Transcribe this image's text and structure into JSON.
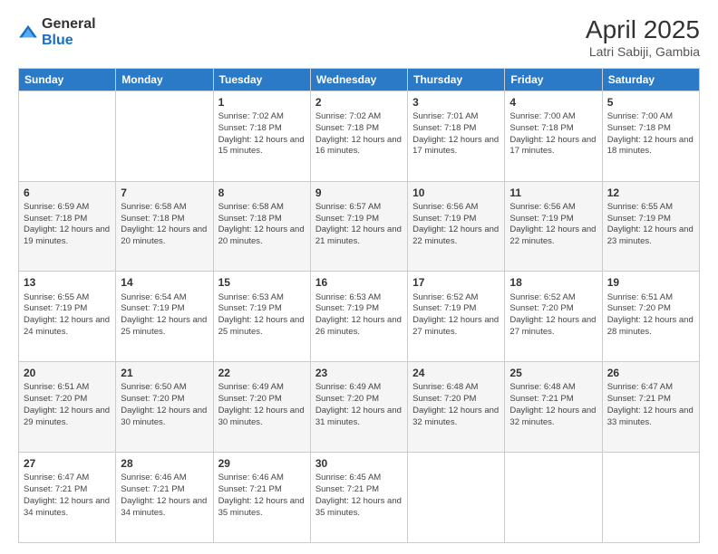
{
  "logo": {
    "general": "General",
    "blue": "Blue"
  },
  "header": {
    "title": "April 2025",
    "subtitle": "Latri Sabiji, Gambia"
  },
  "weekdays": [
    "Sunday",
    "Monday",
    "Tuesday",
    "Wednesday",
    "Thursday",
    "Friday",
    "Saturday"
  ],
  "weeks": [
    [
      {
        "day": "",
        "info": ""
      },
      {
        "day": "",
        "info": ""
      },
      {
        "day": "1",
        "info": "Sunrise: 7:02 AM\nSunset: 7:18 PM\nDaylight: 12 hours and 15 minutes."
      },
      {
        "day": "2",
        "info": "Sunrise: 7:02 AM\nSunset: 7:18 PM\nDaylight: 12 hours and 16 minutes."
      },
      {
        "day": "3",
        "info": "Sunrise: 7:01 AM\nSunset: 7:18 PM\nDaylight: 12 hours and 17 minutes."
      },
      {
        "day": "4",
        "info": "Sunrise: 7:00 AM\nSunset: 7:18 PM\nDaylight: 12 hours and 17 minutes."
      },
      {
        "day": "5",
        "info": "Sunrise: 7:00 AM\nSunset: 7:18 PM\nDaylight: 12 hours and 18 minutes."
      }
    ],
    [
      {
        "day": "6",
        "info": "Sunrise: 6:59 AM\nSunset: 7:18 PM\nDaylight: 12 hours and 19 minutes."
      },
      {
        "day": "7",
        "info": "Sunrise: 6:58 AM\nSunset: 7:18 PM\nDaylight: 12 hours and 20 minutes."
      },
      {
        "day": "8",
        "info": "Sunrise: 6:58 AM\nSunset: 7:18 PM\nDaylight: 12 hours and 20 minutes."
      },
      {
        "day": "9",
        "info": "Sunrise: 6:57 AM\nSunset: 7:19 PM\nDaylight: 12 hours and 21 minutes."
      },
      {
        "day": "10",
        "info": "Sunrise: 6:56 AM\nSunset: 7:19 PM\nDaylight: 12 hours and 22 minutes."
      },
      {
        "day": "11",
        "info": "Sunrise: 6:56 AM\nSunset: 7:19 PM\nDaylight: 12 hours and 22 minutes."
      },
      {
        "day": "12",
        "info": "Sunrise: 6:55 AM\nSunset: 7:19 PM\nDaylight: 12 hours and 23 minutes."
      }
    ],
    [
      {
        "day": "13",
        "info": "Sunrise: 6:55 AM\nSunset: 7:19 PM\nDaylight: 12 hours and 24 minutes."
      },
      {
        "day": "14",
        "info": "Sunrise: 6:54 AM\nSunset: 7:19 PM\nDaylight: 12 hours and 25 minutes."
      },
      {
        "day": "15",
        "info": "Sunrise: 6:53 AM\nSunset: 7:19 PM\nDaylight: 12 hours and 25 minutes."
      },
      {
        "day": "16",
        "info": "Sunrise: 6:53 AM\nSunset: 7:19 PM\nDaylight: 12 hours and 26 minutes."
      },
      {
        "day": "17",
        "info": "Sunrise: 6:52 AM\nSunset: 7:19 PM\nDaylight: 12 hours and 27 minutes."
      },
      {
        "day": "18",
        "info": "Sunrise: 6:52 AM\nSunset: 7:20 PM\nDaylight: 12 hours and 27 minutes."
      },
      {
        "day": "19",
        "info": "Sunrise: 6:51 AM\nSunset: 7:20 PM\nDaylight: 12 hours and 28 minutes."
      }
    ],
    [
      {
        "day": "20",
        "info": "Sunrise: 6:51 AM\nSunset: 7:20 PM\nDaylight: 12 hours and 29 minutes."
      },
      {
        "day": "21",
        "info": "Sunrise: 6:50 AM\nSunset: 7:20 PM\nDaylight: 12 hours and 30 minutes."
      },
      {
        "day": "22",
        "info": "Sunrise: 6:49 AM\nSunset: 7:20 PM\nDaylight: 12 hours and 30 minutes."
      },
      {
        "day": "23",
        "info": "Sunrise: 6:49 AM\nSunset: 7:20 PM\nDaylight: 12 hours and 31 minutes."
      },
      {
        "day": "24",
        "info": "Sunrise: 6:48 AM\nSunset: 7:20 PM\nDaylight: 12 hours and 32 minutes."
      },
      {
        "day": "25",
        "info": "Sunrise: 6:48 AM\nSunset: 7:21 PM\nDaylight: 12 hours and 32 minutes."
      },
      {
        "day": "26",
        "info": "Sunrise: 6:47 AM\nSunset: 7:21 PM\nDaylight: 12 hours and 33 minutes."
      }
    ],
    [
      {
        "day": "27",
        "info": "Sunrise: 6:47 AM\nSunset: 7:21 PM\nDaylight: 12 hours and 34 minutes."
      },
      {
        "day": "28",
        "info": "Sunrise: 6:46 AM\nSunset: 7:21 PM\nDaylight: 12 hours and 34 minutes."
      },
      {
        "day": "29",
        "info": "Sunrise: 6:46 AM\nSunset: 7:21 PM\nDaylight: 12 hours and 35 minutes."
      },
      {
        "day": "30",
        "info": "Sunrise: 6:45 AM\nSunset: 7:21 PM\nDaylight: 12 hours and 35 minutes."
      },
      {
        "day": "",
        "info": ""
      },
      {
        "day": "",
        "info": ""
      },
      {
        "day": "",
        "info": ""
      }
    ]
  ]
}
